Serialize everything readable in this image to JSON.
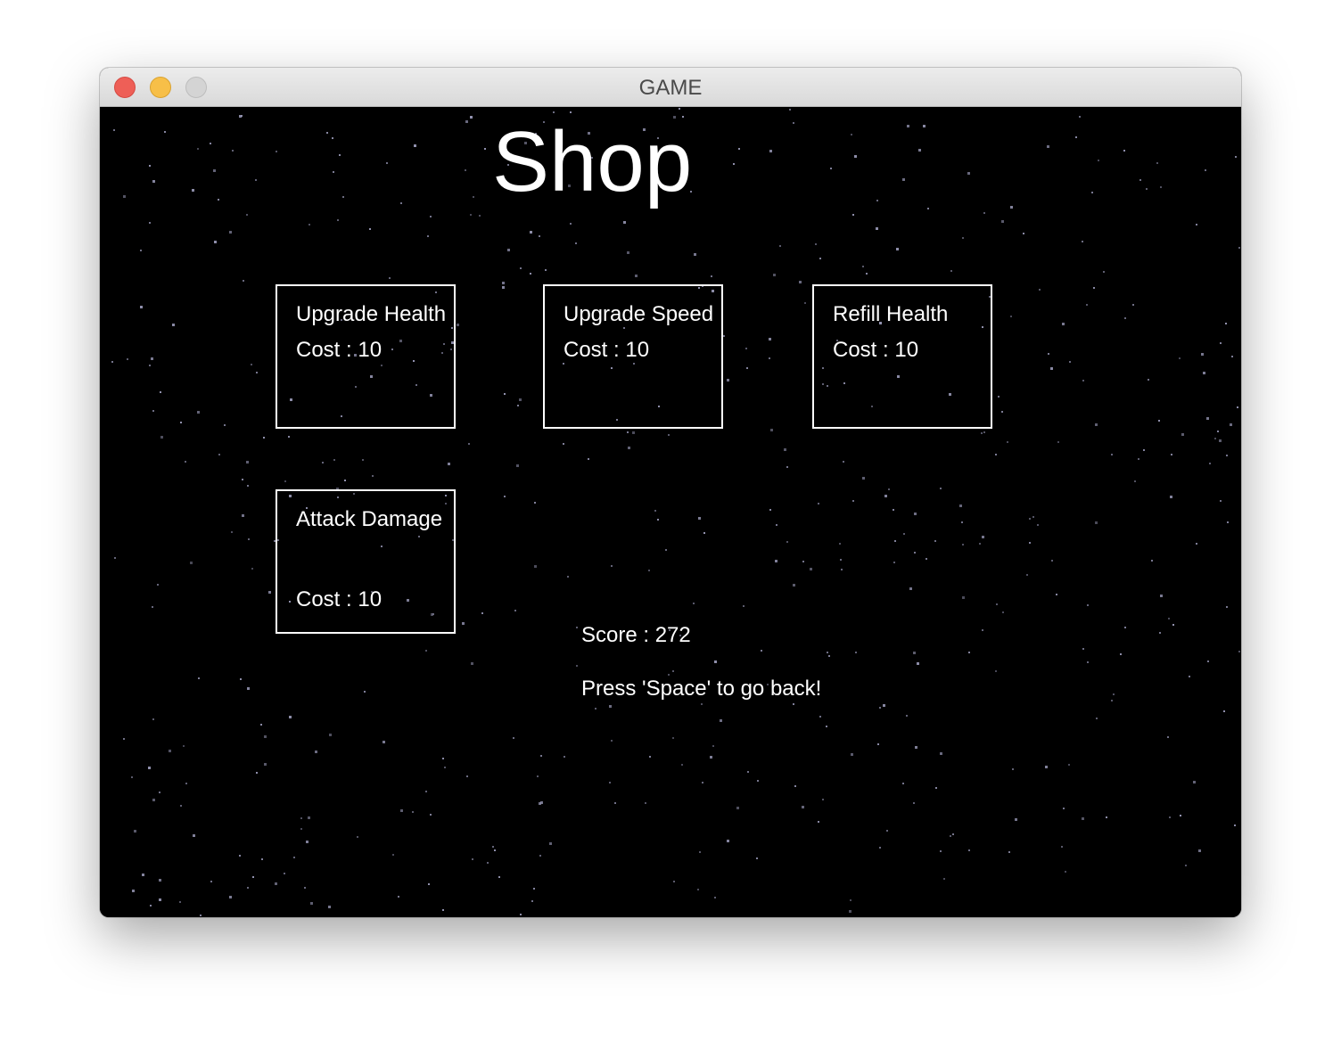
{
  "window": {
    "title": "GAME",
    "controls": [
      "close",
      "minimize",
      "zoom"
    ]
  },
  "shop": {
    "title": "Shop",
    "items": [
      {
        "label": "Upgrade Health",
        "cost": "Cost : 10"
      },
      {
        "label": "Upgrade Speed",
        "cost": "Cost : 10"
      },
      {
        "label": "Refill Health",
        "cost": "Cost : 10"
      },
      {
        "label": "Attack Damage",
        "cost": "Cost : 10"
      }
    ]
  },
  "hud": {
    "score": "Score : 272",
    "hint": "Press 'Space' to go back!"
  },
  "colors": {
    "background": "#000000",
    "text": "#ffffff",
    "star": "#9a9ab8"
  }
}
